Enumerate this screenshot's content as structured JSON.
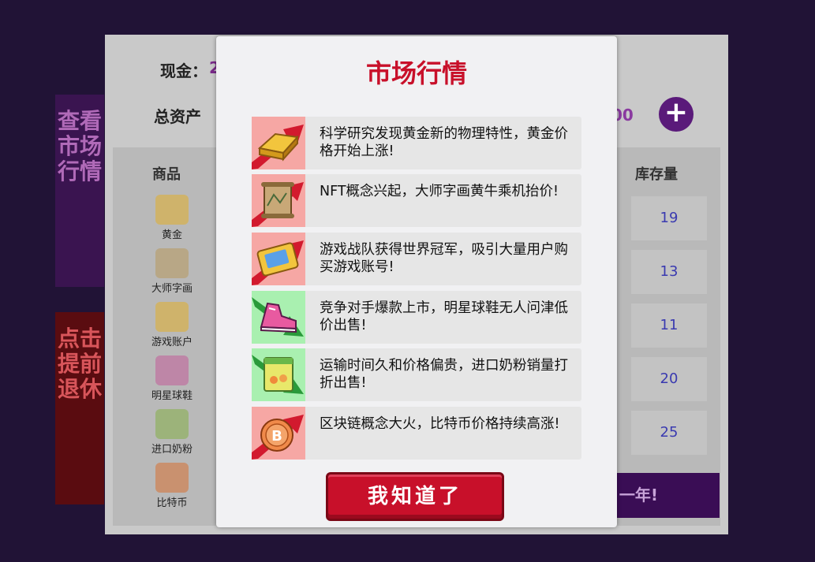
{
  "background": {
    "cash_label": "现金：",
    "cash_value_fragment": "2",
    "assets_label": "总资产",
    "assets_value_fragment": "00",
    "plus_icon": "plus-icon",
    "table_header_goods": "商品",
    "table_header_stock": "库存量",
    "side_market_label": "查看市场行情",
    "side_retire_label": "点击提前退休",
    "next_year_label": "一年!",
    "goods": [
      {
        "name": "黄金",
        "icon": "gold-bar-icon",
        "stock": "19"
      },
      {
        "name": "大师字画",
        "icon": "scroll-painting-icon",
        "stock": "13"
      },
      {
        "name": "游戏账户",
        "icon": "game-card-icon",
        "stock": "11"
      },
      {
        "name": "明星球鞋",
        "icon": "sneaker-icon",
        "stock": "20"
      },
      {
        "name": "进口奶粉",
        "icon": "milk-powder-icon",
        "stock": "25"
      },
      {
        "name": "比特币",
        "icon": "bitcoin-icon",
        "stock": ""
      }
    ]
  },
  "modal": {
    "title": "市场行情",
    "news": [
      {
        "text": "科学研究发现黄金新的物理特性，黄金价格开始上涨!",
        "trend": "up",
        "icon": "gold-bar-icon"
      },
      {
        "text": "NFT概念兴起，大师字画黄牛乘机抬价!",
        "trend": "up",
        "icon": "scroll-painting-icon"
      },
      {
        "text": "游戏战队获得世界冠军，吸引大量用户购买游戏账号!",
        "trend": "up",
        "icon": "game-card-icon"
      },
      {
        "text": "竞争对手爆款上市，明星球鞋无人问津低价出售!",
        "trend": "down",
        "icon": "sneaker-icon"
      },
      {
        "text": "运输时间久和价格偏贵，进口奶粉销量打折出售!",
        "trend": "down",
        "icon": "milk-powder-icon"
      },
      {
        "text": "区块链概念大火，比特币价格持续高涨!",
        "trend": "up",
        "icon": "bitcoin-icon"
      }
    ],
    "ok_button": "我知道了"
  },
  "colors": {
    "up_bg": "#f6a7a4",
    "down_bg": "#a9f0b0",
    "up_arrow": "#d21a2e",
    "down_arrow": "#2a9a3a",
    "title_red": "#c8102a"
  }
}
